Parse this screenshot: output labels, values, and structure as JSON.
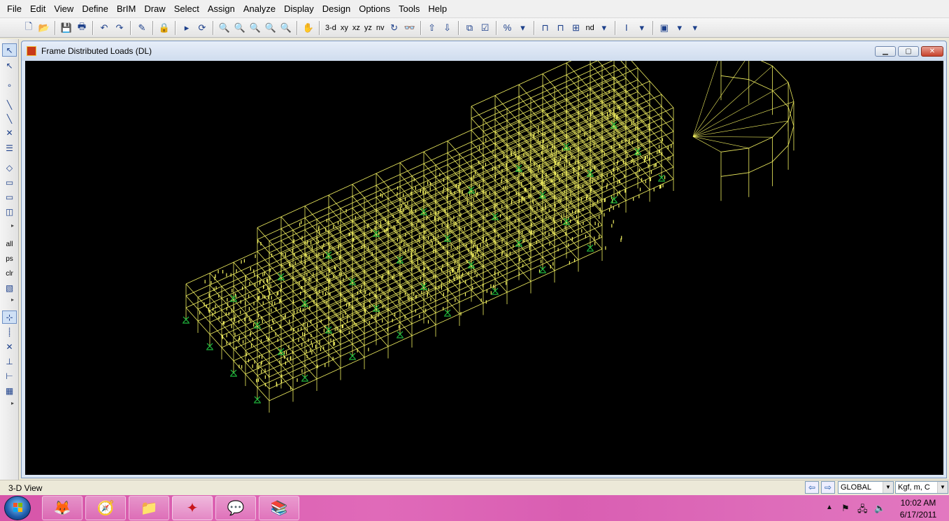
{
  "menu": {
    "items": [
      "File",
      "Edit",
      "View",
      "Define",
      "BrIM",
      "Draw",
      "Select",
      "Assign",
      "Analyze",
      "Display",
      "Design",
      "Options",
      "Tools",
      "Help"
    ]
  },
  "toolbar": {
    "view_3d": "3-d",
    "view_xy": "xy",
    "view_xz": "xz",
    "view_yz": "yz",
    "view_nv": "nv",
    "view_nd": "nd"
  },
  "left_toolbar": {
    "all_label": "all",
    "ps_label": "ps",
    "clr_label": "clr"
  },
  "child_window": {
    "title": "Frame Distributed Loads (DL)"
  },
  "status": {
    "view_name": "3-D View",
    "coord_system": "GLOBAL",
    "units": "Kgf, m, C"
  },
  "taskbar": {
    "time": "10:02 AM",
    "date": "6/17/2011"
  },
  "colors": {
    "frame_lines": "#f2f060",
    "supports": "#22c040",
    "viewport_bg": "#000000",
    "taskbar": "#d95eb2"
  }
}
